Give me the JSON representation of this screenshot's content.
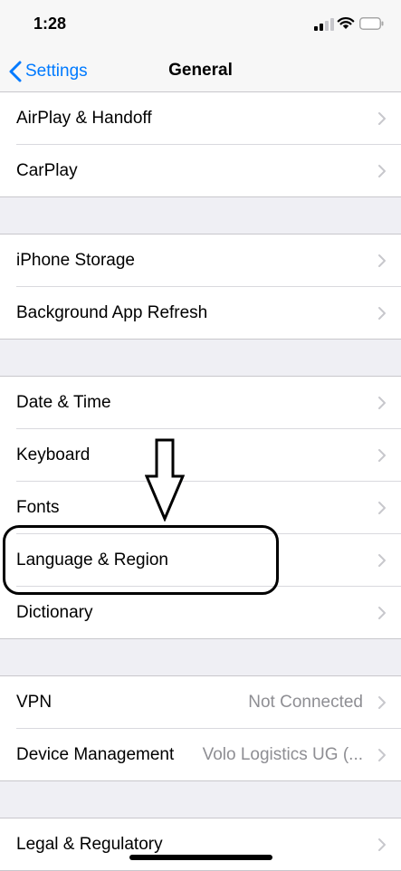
{
  "status_bar": {
    "time": "1:28"
  },
  "nav": {
    "back_label": "Settings",
    "title": "General"
  },
  "groups": [
    {
      "items": [
        {
          "label": "AirPlay & Handoff"
        },
        {
          "label": "CarPlay"
        }
      ]
    },
    {
      "items": [
        {
          "label": "iPhone Storage"
        },
        {
          "label": "Background App Refresh"
        }
      ]
    },
    {
      "items": [
        {
          "label": "Date & Time"
        },
        {
          "label": "Keyboard"
        },
        {
          "label": "Fonts"
        },
        {
          "label": "Language & Region"
        },
        {
          "label": "Dictionary"
        }
      ]
    },
    {
      "items": [
        {
          "label": "VPN",
          "detail": "Not Connected"
        },
        {
          "label": "Device Management",
          "detail": "Volo Logistics UG (..."
        }
      ]
    },
    {
      "items": [
        {
          "label": "Legal & Regulatory"
        }
      ]
    }
  ],
  "icons": {
    "back": "chevron-left-icon",
    "row": "chevron-right-icon",
    "annotation": "down-arrow-icon"
  },
  "colors": {
    "accent": "#007aff",
    "detail": "#8e8e93",
    "background": "#efeff4"
  }
}
